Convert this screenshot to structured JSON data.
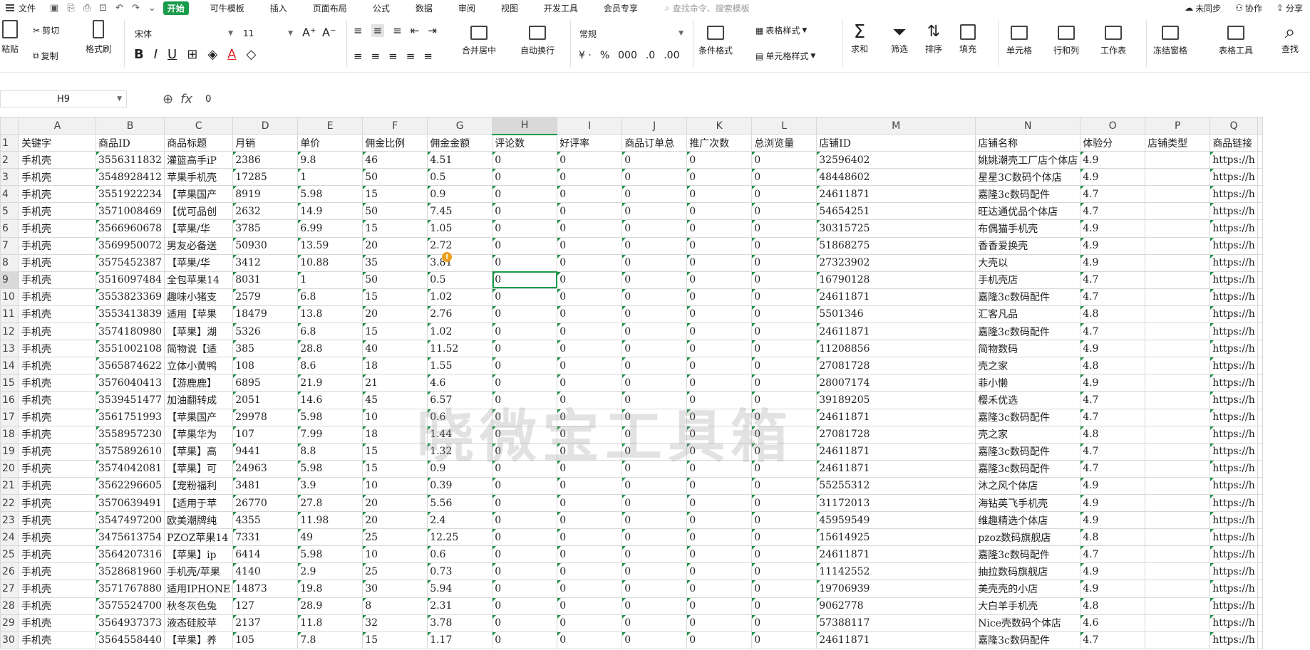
{
  "menu": {
    "file": "文件",
    "tabs": [
      {
        "label": "开始",
        "active": true
      },
      {
        "label": "可牛模板",
        "active": false
      },
      {
        "label": "插入",
        "active": false
      },
      {
        "label": "页面布局",
        "active": false
      },
      {
        "label": "公式",
        "active": false
      },
      {
        "label": "数据",
        "active": false
      },
      {
        "label": "审阅",
        "active": false
      },
      {
        "label": "视图",
        "active": false
      },
      {
        "label": "开发工具",
        "active": false
      },
      {
        "label": "会员专享",
        "active": false
      }
    ],
    "search_placeholder": "查找命令、搜索模板",
    "sync": "未同步",
    "collab": "协作",
    "share": "分享"
  },
  "ribbon": {
    "paste": "粘贴",
    "cut": "剪切",
    "copy": "复制",
    "format_painter": "格式刷",
    "font_name": "宋体",
    "font_size": "11",
    "merge_center": "合并居中",
    "wrap": "自动换行",
    "number_format": "常规",
    "cond_format": "条件格式",
    "table_style": "表格样式",
    "cell_style": "单元格样式",
    "sum": "求和",
    "filter": "筛选",
    "sort": "排序",
    "fill": "填充",
    "cells": "单元格",
    "row_col": "行和列",
    "worksheet": "工作表",
    "freeze": "冻结窗格",
    "table_tools": "表格工具",
    "find": "查找"
  },
  "formula_bar": {
    "name_box": "H9",
    "value": "0"
  },
  "watermark": "晓微宝工具箱",
  "columns": [
    "A",
    "B",
    "C",
    "D",
    "E",
    "F",
    "G",
    "H",
    "I",
    "J",
    "K",
    "L",
    "M",
    "N",
    "O",
    "P",
    "Q"
  ],
  "selected_cell": "H9",
  "headers": [
    "关键字",
    "商品ID",
    "商品标题",
    "月销",
    "单价",
    "佣金比例",
    "佣金金额",
    "评论数",
    "好评率",
    "商品订单总",
    "推广次数",
    "总浏览量",
    "店铺ID",
    "店铺名称",
    "体验分",
    "店铺类型",
    "商品链接"
  ],
  "rows": [
    [
      "手机壳",
      "3556311832",
      "灌篮高手iP",
      "2386",
      "9.8",
      "46",
      "4.51",
      "0",
      "0",
      "0",
      "0",
      "0",
      "32596402",
      "姚姚潮壳工厂店个体店",
      "4.9",
      "",
      "https://h"
    ],
    [
      "手机壳",
      "3548928412",
      "苹果手机壳",
      "17285",
      "1",
      "50",
      "0.5",
      "0",
      "0",
      "0",
      "0",
      "0",
      "48448602",
      "星星3C数码个体店",
      "4.9",
      "",
      "https://h"
    ],
    [
      "手机壳",
      "3551922234",
      "【苹果国产",
      "8919",
      "5.98",
      "15",
      "0.9",
      "0",
      "0",
      "0",
      "0",
      "0",
      "24611871",
      "嘉隆3c数码配件",
      "4.7",
      "",
      "https://h"
    ],
    [
      "手机壳",
      "3571008469",
      "【优可品创",
      "2632",
      "14.9",
      "50",
      "7.45",
      "0",
      "0",
      "0",
      "0",
      "0",
      "54654251",
      "旺达通优品个体店",
      "4.7",
      "",
      "https://h"
    ],
    [
      "手机壳",
      "3566960678",
      "【苹果/华",
      "3785",
      "6.99",
      "15",
      "1.05",
      "0",
      "0",
      "0",
      "0",
      "0",
      "30315725",
      "布偶猫手机壳",
      "4.9",
      "",
      "https://h"
    ],
    [
      "手机壳",
      "3569950072",
      "男友必备送",
      "50930",
      "13.59",
      "20",
      "2.72",
      "0",
      "0",
      "0",
      "0",
      "0",
      "51868275",
      "香香爱换壳",
      "4.9",
      "",
      "https://h"
    ],
    [
      "手机壳",
      "3575452387",
      "【苹果/华",
      "3412",
      "10.88",
      "35",
      "3.81",
      "0",
      "0",
      "0",
      "0",
      "0",
      "27323902",
      "大壳以",
      "4.9",
      "",
      "https://h"
    ],
    [
      "手机壳",
      "3516097484",
      "全包苹果14",
      "8031",
      "1",
      "50",
      "0.5",
      "0",
      "0",
      "0",
      "0",
      "0",
      "16790128",
      "手机壳店",
      "4.7",
      "",
      "https://h"
    ],
    [
      "手机壳",
      "3553823369",
      "趣味小猪支",
      "2579",
      "6.8",
      "15",
      "1.02",
      "0",
      "0",
      "0",
      "0",
      "0",
      "24611871",
      "嘉隆3c数码配件",
      "4.7",
      "",
      "https://h"
    ],
    [
      "手机壳",
      "3553413839",
      "适用【苹果",
      "18479",
      "13.8",
      "20",
      "2.76",
      "0",
      "0",
      "0",
      "0",
      "0",
      "5501346",
      "汇客凡品",
      "4.8",
      "",
      "https://h"
    ],
    [
      "手机壳",
      "3574180980",
      "【苹果】湖",
      "5326",
      "6.8",
      "15",
      "1.02",
      "0",
      "0",
      "0",
      "0",
      "0",
      "24611871",
      "嘉隆3c数码配件",
      "4.7",
      "",
      "https://h"
    ],
    [
      "手机壳",
      "3551002108",
      "简物说【适",
      "385",
      "28.8",
      "40",
      "11.52",
      "0",
      "0",
      "0",
      "0",
      "0",
      "11208856",
      "简物数码",
      "4.9",
      "",
      "https://h"
    ],
    [
      "手机壳",
      "3565874622",
      "立体小黄鸭",
      "108",
      "8.6",
      "18",
      "1.55",
      "0",
      "0",
      "0",
      "0",
      "0",
      "27081728",
      "壳之家",
      "4.8",
      "",
      "https://h"
    ],
    [
      "手机壳",
      "3576040413",
      "【游鹿鹿】",
      "6895",
      "21.9",
      "21",
      "4.6",
      "0",
      "0",
      "0",
      "0",
      "0",
      "28007174",
      "菲小懒",
      "4.9",
      "",
      "https://h"
    ],
    [
      "手机壳",
      "3539451477",
      "加油翻转成",
      "2051",
      "14.6",
      "45",
      "6.57",
      "0",
      "0",
      "0",
      "0",
      "0",
      "39189205",
      "樱禾优选",
      "4.7",
      "",
      "https://h"
    ],
    [
      "手机壳",
      "3561751993",
      "【苹果国产",
      "29978",
      "5.98",
      "10",
      "0.6",
      "0",
      "0",
      "0",
      "0",
      "0",
      "24611871",
      "嘉隆3c数码配件",
      "4.7",
      "",
      "https://h"
    ],
    [
      "手机壳",
      "3558957230",
      "【苹果华为",
      "107",
      "7.99",
      "18",
      "1.44",
      "0",
      "0",
      "0",
      "0",
      "0",
      "27081728",
      "壳之家",
      "4.8",
      "",
      "https://h"
    ],
    [
      "手机壳",
      "3575892610",
      "【苹果】高",
      "9441",
      "8.8",
      "15",
      "1.32",
      "0",
      "0",
      "0",
      "0",
      "0",
      "24611871",
      "嘉隆3c数码配件",
      "4.7",
      "",
      "https://h"
    ],
    [
      "手机壳",
      "3574042081",
      "【苹果】可",
      "24963",
      "5.98",
      "15",
      "0.9",
      "0",
      "0",
      "0",
      "0",
      "0",
      "24611871",
      "嘉隆3c数码配件",
      "4.7",
      "",
      "https://h"
    ],
    [
      "手机壳",
      "3562296605",
      "【宠粉福利",
      "3481",
      "3.9",
      "10",
      "0.39",
      "0",
      "0",
      "0",
      "0",
      "0",
      "55255312",
      "沐之风个体店",
      "4.9",
      "",
      "https://h"
    ],
    [
      "手机壳",
      "3570639491",
      "【适用于苹",
      "26770",
      "27.8",
      "20",
      "5.56",
      "0",
      "0",
      "0",
      "0",
      "0",
      "31172013",
      "海钻英飞手机壳",
      "4.9",
      "",
      "https://h"
    ],
    [
      "手机壳",
      "3547497200",
      "欧美潮牌纯",
      "4355",
      "11.98",
      "20",
      "2.4",
      "0",
      "0",
      "0",
      "0",
      "0",
      "45959549",
      "维趣精选个体店",
      "4.9",
      "",
      "https://h"
    ],
    [
      "手机壳",
      "3475613754",
      "PZOZ苹果14",
      "7331",
      "49",
      "25",
      "12.25",
      "0",
      "0",
      "0",
      "0",
      "0",
      "15614925",
      "pzoz数码旗舰店",
      "4.8",
      "",
      "https://h"
    ],
    [
      "手机壳",
      "3564207316",
      "【苹果】ip",
      "6414",
      "5.98",
      "10",
      "0.6",
      "0",
      "0",
      "0",
      "0",
      "0",
      "24611871",
      "嘉隆3c数码配件",
      "4.7",
      "",
      "https://h"
    ],
    [
      "手机壳",
      "3528681960",
      "手机壳/苹果",
      "4140",
      "2.9",
      "25",
      "0.73",
      "0",
      "0",
      "0",
      "0",
      "0",
      "11142552",
      "抽拉数码旗舰店",
      "4.9",
      "",
      "https://h"
    ],
    [
      "手机壳",
      "3571767880",
      "适用IPHONE",
      "14873",
      "19.8",
      "30",
      "5.94",
      "0",
      "0",
      "0",
      "0",
      "0",
      "19706939",
      "美壳壳的小店",
      "4.9",
      "",
      "https://h"
    ],
    [
      "手机壳",
      "3575524700",
      "秋冬灰色兔",
      "127",
      "28.9",
      "8",
      "2.31",
      "0",
      "0",
      "0",
      "0",
      "0",
      "9062778",
      "大白羊手机壳",
      "4.8",
      "",
      "https://h"
    ],
    [
      "手机壳",
      "3564937373",
      "液态硅胶苹",
      "2137",
      "11.8",
      "32",
      "3.78",
      "0",
      "0",
      "0",
      "0",
      "0",
      "57388117",
      "Nice壳数码个体店",
      "4.6",
      "",
      "https://h"
    ],
    [
      "手机壳",
      "3564558440",
      "【苹果】养",
      "105",
      "7.8",
      "15",
      "1.17",
      "0",
      "0",
      "0",
      "0",
      "0",
      "24611871",
      "嘉隆3c数码配件",
      "4.7",
      "",
      "https://h"
    ]
  ]
}
